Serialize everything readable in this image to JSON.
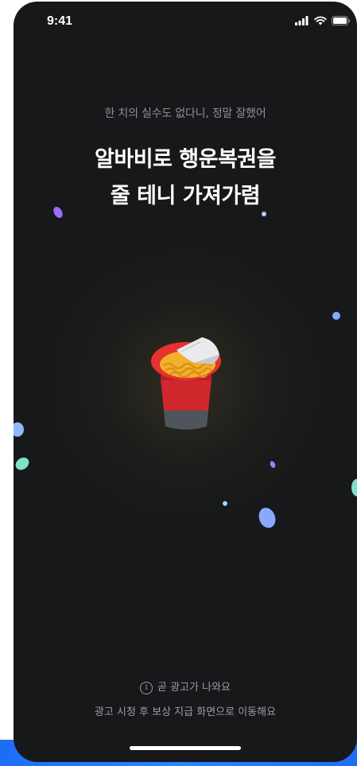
{
  "status_bar": {
    "time": "9:41",
    "icons": [
      "cellular-signal-icon",
      "wifi-icon",
      "battery-icon"
    ]
  },
  "reward_screen": {
    "subtitle": "한 치의 실수도 없다니, 정말 잘했어",
    "headline_line1": "알바비로 행운복권을",
    "headline_line2": "줄 테니 가져가렴",
    "illustration": "cup-noodle-icon",
    "notice": "곧 광고가 나와요",
    "notice_icon": "info-icon",
    "notice_sub": "광고 시청 후 보상 지급 화면으로 이동해요"
  },
  "colors": {
    "background": "#17181a",
    "accent_blue": "#1e6ef5",
    "cup_red": "#d0272d",
    "noodle_yellow": "#f2b12c"
  }
}
